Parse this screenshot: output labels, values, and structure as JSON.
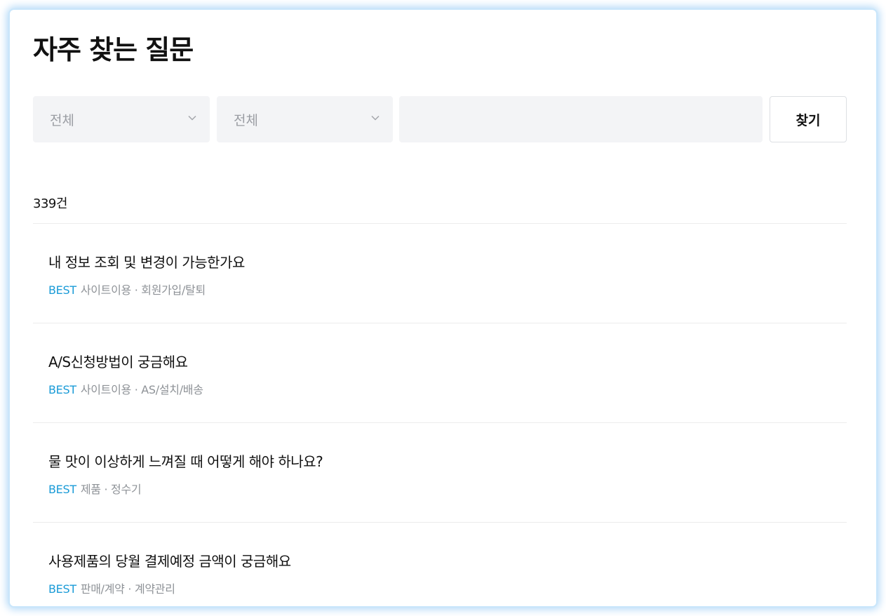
{
  "page": {
    "title": "자주 찾는 질문"
  },
  "filters": {
    "category_1": {
      "selected": "전체"
    },
    "category_2": {
      "selected": "전체"
    },
    "search": {
      "value": "",
      "placeholder": ""
    },
    "search_button_label": "찾기"
  },
  "results": {
    "count_label": "339건"
  },
  "faq": [
    {
      "question": "내 정보 조회 및 변경이 가능한가요",
      "badge": "BEST",
      "category": "사이트이용 · 회원가입/탈퇴"
    },
    {
      "question": "A/S신청방법이 궁금해요",
      "badge": "BEST",
      "category": "사이트이용 · AS/설치/배송"
    },
    {
      "question": "물 맛이 이상하게 느껴질 때 어떻게 해야 하나요?",
      "badge": "BEST",
      "category": "제품 · 정수기"
    },
    {
      "question": "사용제품의 당월 결제예정 금액이 궁금해요",
      "badge": "BEST",
      "category": "판매/계약 · 계약관리"
    }
  ],
  "colors": {
    "badge": "#1a9bd7",
    "frame_glow": "#aed6f7"
  },
  "icons": {
    "dropdown": "chevron-down-icon"
  }
}
